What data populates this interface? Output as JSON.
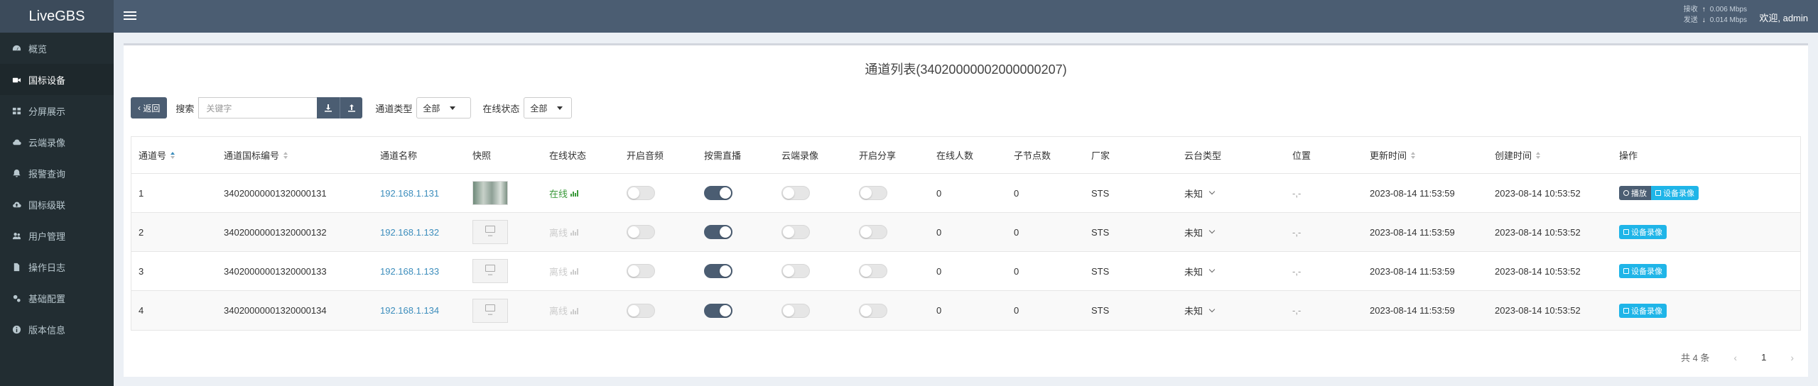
{
  "app": {
    "logo": "LiveGBS"
  },
  "sidebar": {
    "items": [
      {
        "label": "概览",
        "icon": "dashboard-icon",
        "active": false
      },
      {
        "label": "国标设备",
        "icon": "video-camera-icon",
        "active": true
      },
      {
        "label": "分屏展示",
        "icon": "grid-icon",
        "active": false
      },
      {
        "label": "云端录像",
        "icon": "cloud-icon",
        "active": false
      },
      {
        "label": "报警查询",
        "icon": "bell-icon",
        "active": false
      },
      {
        "label": "国标级联",
        "icon": "cloud-upload-icon",
        "active": false
      },
      {
        "label": "用户管理",
        "icon": "users-icon",
        "active": false
      },
      {
        "label": "操作日志",
        "icon": "file-icon",
        "active": false
      },
      {
        "label": "基础配置",
        "icon": "cogs-icon",
        "active": false
      },
      {
        "label": "版本信息",
        "icon": "info-icon",
        "active": false
      }
    ]
  },
  "header": {
    "net_recv_label": "接收",
    "net_recv_value": "0.006 Mbps",
    "net_send_label": "发送",
    "net_send_value": "0.014 Mbps",
    "welcome": "欢迎, admin"
  },
  "page": {
    "title": "通道列表(34020000002000000207)",
    "back_label": "返回",
    "search_label": "搜索",
    "search_placeholder": "关键字",
    "channel_type_label": "通道类型",
    "channel_type_value": "全部",
    "online_status_label": "在线状态",
    "online_status_value": "全部"
  },
  "table": {
    "headers": [
      "通道号",
      "通道国标编号",
      "通道名称",
      "快照",
      "在线状态",
      "开启音频",
      "按需直播",
      "云端录像",
      "开启分享",
      "在线人数",
      "子节点数",
      "厂家",
      "云台类型",
      "位置",
      "更新时间",
      "创建时间",
      "操作"
    ],
    "rows": [
      {
        "no": "1",
        "gb_id": "34020000001320000131",
        "name": "192.168.1.131",
        "snapshot": "live",
        "status": "在线",
        "online": true,
        "audio": false,
        "on_demand": true,
        "cloud_rec": false,
        "share": false,
        "viewers": "0",
        "children": "0",
        "vendor": "STS",
        "ptz": "未知",
        "position": "-,-",
        "updated": "2023-08-14 11:53:59",
        "created": "2023-08-14 10:53:52",
        "play_label": "播放",
        "rec_label": "设备录像"
      },
      {
        "no": "2",
        "gb_id": "34020000001320000132",
        "name": "192.168.1.132",
        "snapshot": "none",
        "status": "离线",
        "online": false,
        "audio": false,
        "on_demand": true,
        "cloud_rec": false,
        "share": false,
        "viewers": "0",
        "children": "0",
        "vendor": "STS",
        "ptz": "未知",
        "position": "-,-",
        "updated": "2023-08-14 11:53:59",
        "created": "2023-08-14 10:53:52",
        "play_label": "",
        "rec_label": "设备录像"
      },
      {
        "no": "3",
        "gb_id": "34020000001320000133",
        "name": "192.168.1.133",
        "snapshot": "none",
        "status": "离线",
        "online": false,
        "audio": false,
        "on_demand": true,
        "cloud_rec": false,
        "share": false,
        "viewers": "0",
        "children": "0",
        "vendor": "STS",
        "ptz": "未知",
        "position": "-,-",
        "updated": "2023-08-14 11:53:59",
        "created": "2023-08-14 10:53:52",
        "play_label": "",
        "rec_label": "设备录像"
      },
      {
        "no": "4",
        "gb_id": "34020000001320000134",
        "name": "192.168.1.134",
        "snapshot": "none",
        "status": "离线",
        "online": false,
        "audio": false,
        "on_demand": true,
        "cloud_rec": false,
        "share": false,
        "viewers": "0",
        "children": "0",
        "vendor": "STS",
        "ptz": "未知",
        "position": "-,-",
        "updated": "2023-08-14 11:53:59",
        "created": "2023-08-14 10:53:52",
        "play_label": "",
        "rec_label": "设备录像"
      }
    ]
  },
  "pager": {
    "total": "共 4 条",
    "current": "1",
    "prev": "‹",
    "next": "›"
  },
  "colors": {
    "header": "#4b5d72",
    "sidebar": "#222d32",
    "accent": "#1fb5e8",
    "online": "#3c9a3c"
  }
}
